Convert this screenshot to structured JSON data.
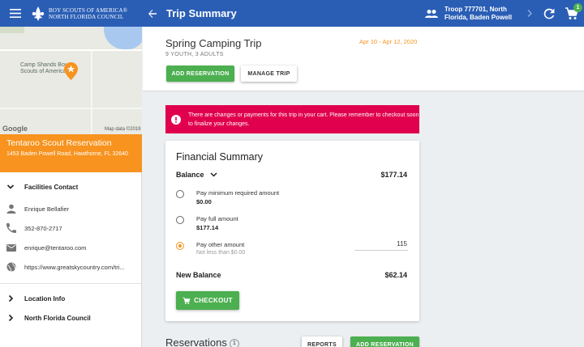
{
  "header": {
    "logo_line1": "BOY SCOUTS OF AMERICA®",
    "logo_line2": "NORTH FLORIDA COUNCIL",
    "page_title": "Trip Summary",
    "troop_line1": "Troop 777701, North",
    "troop_line2": "Florida, Baden Powell",
    "cart_count": "1"
  },
  "sidebar": {
    "map_label_line1": "Camp Shands Boy",
    "map_label_line2": "Scouts of America",
    "map_google": "Google",
    "map_attribution": "Map data ©2019",
    "venue_name": "Tentaroo Scout Reservation",
    "venue_address": "1453 Baden Powell Road, Hawthorne, FL 32640",
    "contact_heading": "Facilities Contact",
    "contact_name": "Enrique Bellafier",
    "contact_phone": "352-870-2717",
    "contact_email": "enrique@tentaroo.com",
    "contact_website": "https://www.greatskycountry.com/tri...",
    "location_info": "Location Info",
    "council": "North Florida Council"
  },
  "trip": {
    "name": "Spring Camping Trip",
    "attendees": "9 YOUTH, 3 ADULTS",
    "dates": "Apr 10 - Apr 12, 2020",
    "add_reservation_label": "ADD RESERVATION",
    "manage_trip_label": "MANAGE TRIP"
  },
  "alert": {
    "message": "There are changes or payments for this trip in your cart. Please remember to checkout soon to finalize your changes."
  },
  "financial": {
    "title": "Financial Summary",
    "balance_label": "Balance",
    "balance_value": "$177.14",
    "options": [
      {
        "label": "Pay minimum required amount",
        "amount": "$0.00",
        "selected": false
      },
      {
        "label": "Pay full amount",
        "amount": "$177.14",
        "selected": false
      },
      {
        "label": "Pay other amount",
        "hint": "Not less than $0.00",
        "selected": true
      }
    ],
    "other_amount_value": "115",
    "new_balance_label": "New Balance",
    "new_balance_value": "$62.14",
    "checkout_label": "CHECKOUT"
  },
  "reservations": {
    "title": "Reservations",
    "count": "1",
    "reports_label": "REPORTS",
    "add_reservation_label": "ADD RESERVATION"
  },
  "colors": {
    "topbar": "#2a5eb5",
    "accent_orange": "#f7931e",
    "alert_red": "#e0004d",
    "primary_green": "#4caf50"
  }
}
